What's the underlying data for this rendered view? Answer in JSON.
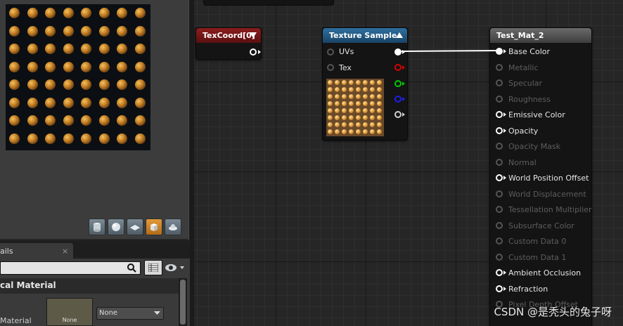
{
  "details": {
    "tab_label": "ails",
    "tab_close": "×",
    "section_title": "cal Material",
    "material_label": "Material",
    "thumbnail_label": "None",
    "dropdown_value": "None"
  },
  "nodes": {
    "texcoord": {
      "title": "TexCoord[0]"
    },
    "texture_sample": {
      "title": "Texture Sample",
      "inputs": [
        "UVs",
        "Tex"
      ]
    },
    "result": {
      "title": "Test_Mat_2",
      "pins": [
        {
          "label": "Base Color",
          "enabled": true,
          "connected": true
        },
        {
          "label": "Metallic",
          "enabled": false
        },
        {
          "label": "Specular",
          "enabled": false
        },
        {
          "label": "Roughness",
          "enabled": false
        },
        {
          "label": "Emissive Color",
          "enabled": true
        },
        {
          "label": "Opacity",
          "enabled": true
        },
        {
          "label": "Opacity Mask",
          "enabled": false
        },
        {
          "label": "Normal",
          "enabled": false
        },
        {
          "label": "World Position Offset",
          "enabled": true
        },
        {
          "label": "World Displacement",
          "enabled": false
        },
        {
          "label": "Tessellation Multiplier",
          "enabled": false
        },
        {
          "label": "Subsurface Color",
          "enabled": false
        },
        {
          "label": "Custom Data 0",
          "enabled": false
        },
        {
          "label": "Custom Data 1",
          "enabled": false
        },
        {
          "label": "Ambient Occlusion",
          "enabled": true
        },
        {
          "label": "Refraction",
          "enabled": true
        },
        {
          "label": "Pixel Depth Offset",
          "enabled": false
        }
      ]
    }
  },
  "colors": {
    "texcoord_header": "#8c1d1d",
    "texture_header": "#2f6fa0",
    "result_header": "#5a5a5a",
    "active_shape_button": "#e29a3a"
  },
  "watermark": "CSDN @是秃头的兔子呀"
}
